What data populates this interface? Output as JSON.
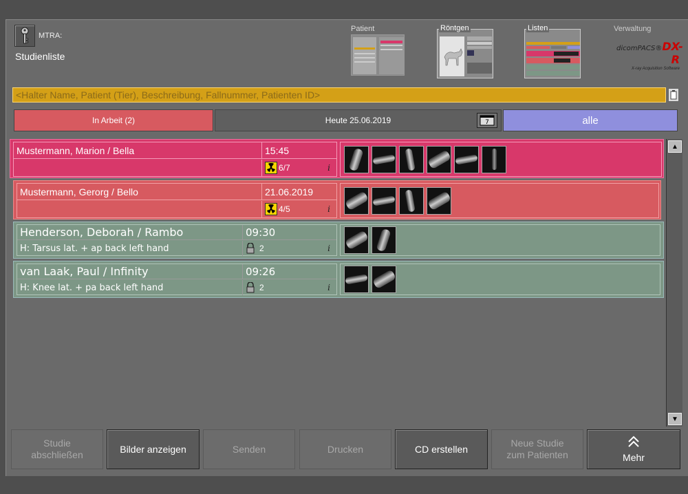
{
  "header": {
    "user_label": "MTRA:",
    "page_title": "Studienliste",
    "nav": {
      "patient": "Patient",
      "roentgen": "Röntgen",
      "listen": "Listen",
      "verwaltung": "Verwaltung"
    },
    "logo": {
      "brand": "dicomPACS®",
      "product": "DX-R",
      "tagline": "X-ray Acquisition Software"
    }
  },
  "search": {
    "placeholder": "<Halter Name, Patient (Tier), Beschreibung, Fallnummer, Patienten ID>"
  },
  "filters": {
    "in_arbeit": "In Arbeit (2)",
    "heute": "Heute 25.06.2019",
    "alle": "alle"
  },
  "rows": [
    {
      "name": "Mustermann, Marion / Bella",
      "time": "15:45",
      "description": "",
      "status": "6/7",
      "status_icon": "radiation-icon",
      "thumbnails": 6,
      "color": "#d8386a"
    },
    {
      "name": "Mustermann, Gerorg / Bello",
      "time": "21.06.2019",
      "description": "",
      "status": "4/5",
      "status_icon": "radiation-icon",
      "thumbnails": 4,
      "color": "#d75a60"
    },
    {
      "name": "Henderson, Deborah / Rambo",
      "time": "09:30",
      "description": "H: Tarsus lat. + ap back left hand",
      "status": "2",
      "status_icon": "lock-icon",
      "thumbnails": 2,
      "color": "#7d9786"
    },
    {
      "name": "van Laak, Paul / Infinity",
      "time": "09:26",
      "description": "H: Knee lat. + pa back left hand",
      "status": "2",
      "status_icon": "lock-icon",
      "thumbnails": 2,
      "color": "#7d9786"
    }
  ],
  "buttons": {
    "studie_abschliessen_1": "Studie",
    "studie_abschliessen_2": "abschließen",
    "bilder_anzeigen": "Bilder anzeigen",
    "senden": "Senden",
    "drucken": "Drucken",
    "cd_erstellen": "CD erstellen",
    "neue_studie_1": "Neue Studie",
    "neue_studie_2": "zum Patienten",
    "mehr": "Mehr"
  }
}
